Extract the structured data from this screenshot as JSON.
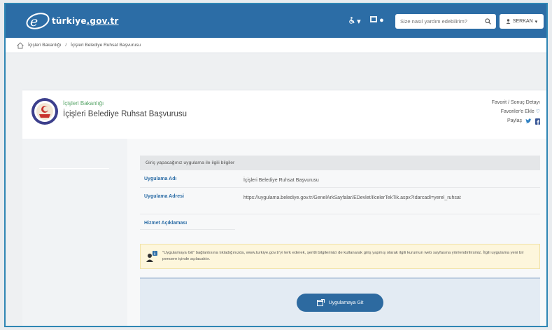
{
  "header": {
    "logo_prefix": "türkiye",
    "logo_domain": ".gov.tr",
    "accessibility_icon": "wheelchair-icon",
    "accessibility_caret": "▾",
    "language_icon": "flag-icon",
    "search": {
      "placeholder": "Size nasıl yardım edebilirim?"
    },
    "user": {
      "name": "SERKAN",
      "caret": "▾"
    }
  },
  "breadcrumb": {
    "items": [
      "İçişleri Bakanlığı",
      "İçişleri Belediye Ruhsat Başvurusu"
    ],
    "separator": "/"
  },
  "service": {
    "institution": "İçişleri Bakanlığı",
    "title": "İçişleri Belediye Ruhsat Başvurusu",
    "links": [
      "Favorit / Sonuç Detayı",
      "Favoriler'e Ekle"
    ],
    "share_label": "Paylaş"
  },
  "info": {
    "heading": "Giriş yapacağınız uygulama ile ilgili bilgiler",
    "rows": [
      {
        "label": "Uygulama Adı",
        "value": "İçişleri Belediye Ruhsat Başvurusu"
      },
      {
        "label": "Uygulama Adresi",
        "value": "https://uygulama.belediye.gov.tr/GenelArkSayfalar/EDevlet/IlcelerTekTik.aspx?IdarcadI=yerel_ruhsat"
      },
      {
        "label": "Hizmet Açıklaması",
        "value": ""
      }
    ]
  },
  "warning": {
    "text": "\"Uygulamaya Git\" bağlantısına tıkladığınızda, www.turkiye.gov.tr'yi terk ederek, şeritli bilgilerinizi de kullanarak giriş yapmış olarak ilgili kurumun web sayfasına yönlendirilirsiniz. İlgili uygulama yeni bir pencere içinde açılacaktır."
  },
  "go_button": {
    "label": "Uygulamaya Git"
  },
  "colors": {
    "header_bg": "#2c6da6",
    "accent_blue": "#2c6da6",
    "institution_green": "#5aa66a",
    "warning_bg": "#fdf6dc"
  }
}
